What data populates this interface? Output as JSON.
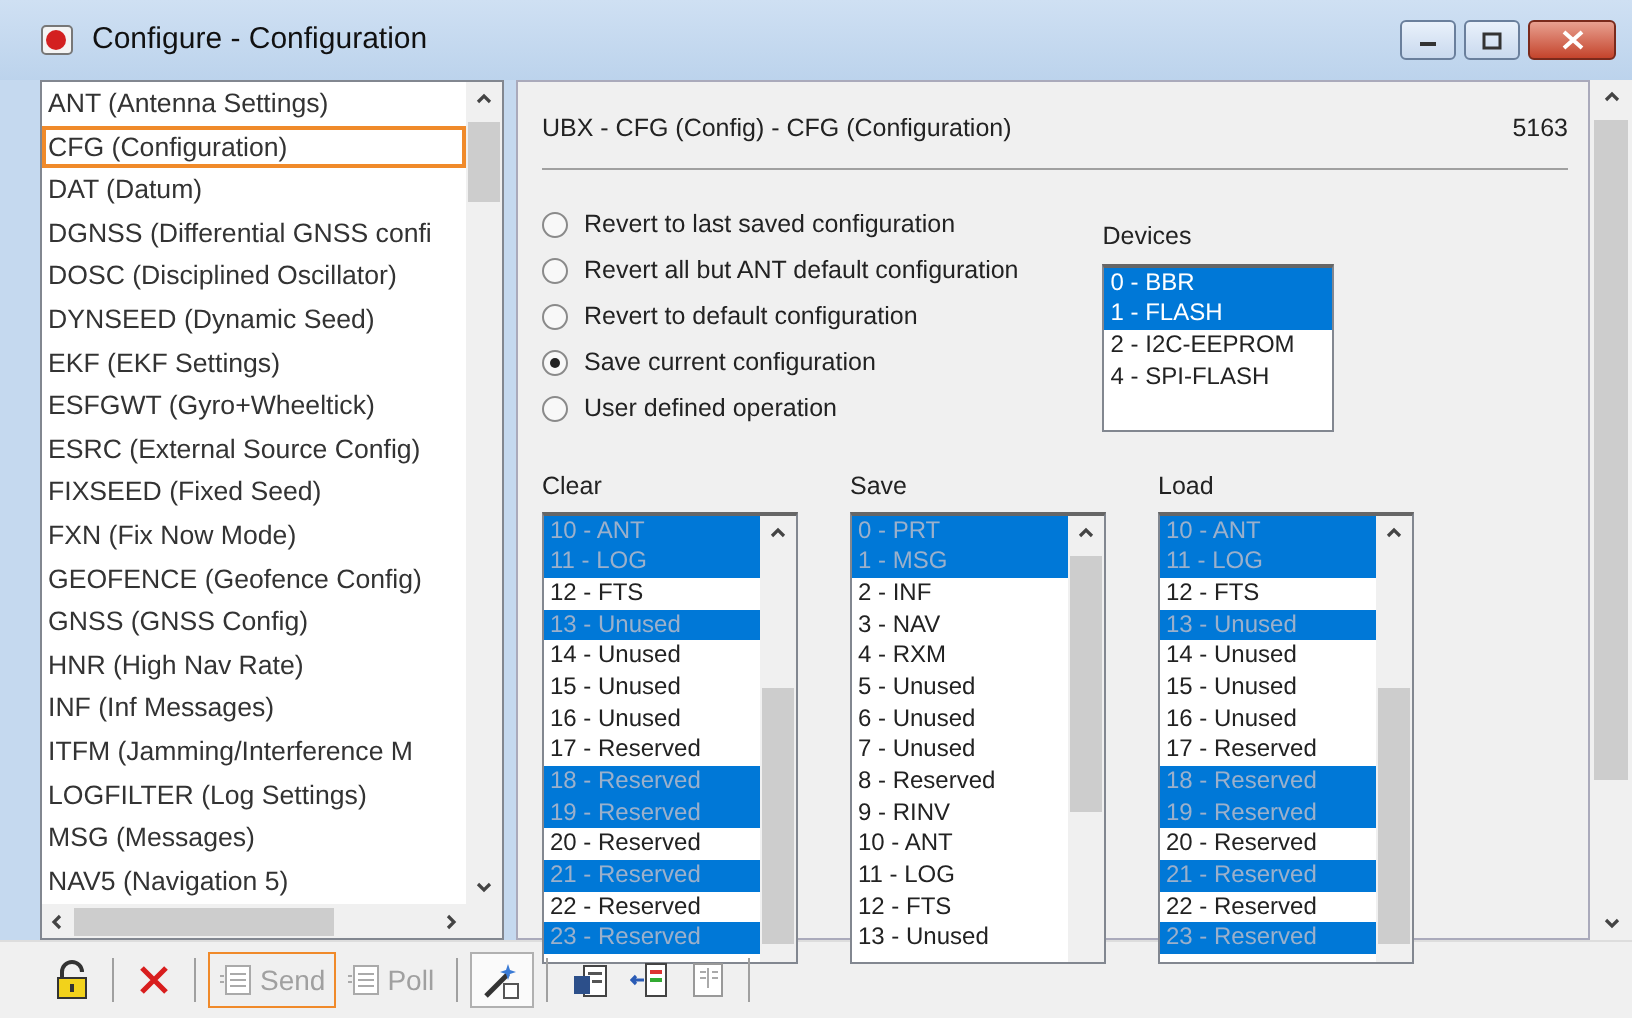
{
  "window": {
    "title": "Configure - Configuration"
  },
  "messages": [
    {
      "label": "ANT (Antenna Settings)",
      "selected": false
    },
    {
      "label": "CFG (Configuration)",
      "selected": true
    },
    {
      "label": "DAT (Datum)",
      "selected": false
    },
    {
      "label": "DGNSS (Differential GNSS confi",
      "selected": false
    },
    {
      "label": "DOSC (Disciplined Oscillator)",
      "selected": false
    },
    {
      "label": "DYNSEED (Dynamic Seed)",
      "selected": false
    },
    {
      "label": "EKF (EKF Settings)",
      "selected": false
    },
    {
      "label": "ESFGWT (Gyro+Wheeltick)",
      "selected": false
    },
    {
      "label": "ESRC (External Source Config)",
      "selected": false
    },
    {
      "label": "FIXSEED (Fixed Seed)",
      "selected": false
    },
    {
      "label": "FXN (Fix Now Mode)",
      "selected": false
    },
    {
      "label": "GEOFENCE (Geofence Config)",
      "selected": false
    },
    {
      "label": "GNSS (GNSS Config)",
      "selected": false
    },
    {
      "label": "HNR (High Nav Rate)",
      "selected": false
    },
    {
      "label": "INF (Inf Messages)",
      "selected": false
    },
    {
      "label": "ITFM (Jamming/Interference M",
      "selected": false
    },
    {
      "label": "LOGFILTER (Log Settings)",
      "selected": false
    },
    {
      "label": "MSG (Messages)",
      "selected": false
    },
    {
      "label": "NAV5 (Navigation 5)",
      "selected": false
    }
  ],
  "panel": {
    "header": "UBX - CFG (Config) - CFG (Configuration)",
    "number": "5163",
    "options": [
      {
        "label": "Revert to last saved configuration",
        "selected": false
      },
      {
        "label": "Revert all but ANT default configuration",
        "selected": false
      },
      {
        "label": "Revert to default configuration",
        "selected": false
      },
      {
        "label": "Save current configuration",
        "selected": true
      },
      {
        "label": "User defined operation",
        "selected": false
      }
    ],
    "devices": {
      "label": "Devices",
      "items": [
        {
          "label": "0 - BBR",
          "selected": true
        },
        {
          "label": "1 - FLASH",
          "selected": true
        },
        {
          "label": "2 - I2C-EEPROM",
          "selected": false
        },
        {
          "label": "4 - SPI-FLASH",
          "selected": false
        }
      ]
    },
    "masks": [
      {
        "label": "Clear",
        "items": [
          {
            "label": "10 - ANT",
            "selected": true
          },
          {
            "label": "11 - LOG",
            "selected": true
          },
          {
            "label": "12 - FTS",
            "selected": false
          },
          {
            "label": "13 - Unused",
            "selected": true
          },
          {
            "label": "14 - Unused",
            "selected": false
          },
          {
            "label": "15 - Unused",
            "selected": false
          },
          {
            "label": "16 - Unused",
            "selected": false
          },
          {
            "label": "17 - Reserved",
            "selected": false
          },
          {
            "label": "18 - Reserved",
            "selected": true
          },
          {
            "label": "19 - Reserved",
            "selected": true
          },
          {
            "label": "20 - Reserved",
            "selected": false
          },
          {
            "label": "21 - Reserved",
            "selected": true
          },
          {
            "label": "22 - Reserved",
            "selected": false
          },
          {
            "label": "23 - Reserved",
            "selected": true
          }
        ]
      },
      {
        "label": "Save",
        "items": [
          {
            "label": "0 - PRT",
            "selected": true
          },
          {
            "label": "1 - MSG",
            "selected": true
          },
          {
            "label": "2 - INF",
            "selected": false
          },
          {
            "label": "3 - NAV",
            "selected": false
          },
          {
            "label": "4 - RXM",
            "selected": false
          },
          {
            "label": "5 - Unused",
            "selected": false
          },
          {
            "label": "6 - Unused",
            "selected": false
          },
          {
            "label": "7 - Unused",
            "selected": false
          },
          {
            "label": "8 - Reserved",
            "selected": false
          },
          {
            "label": "9 - RINV",
            "selected": false
          },
          {
            "label": "10 - ANT",
            "selected": false
          },
          {
            "label": "11 - LOG",
            "selected": false
          },
          {
            "label": "12 - FTS",
            "selected": false
          },
          {
            "label": "13 - Unused",
            "selected": false
          }
        ]
      },
      {
        "label": "Load",
        "items": [
          {
            "label": "10 - ANT",
            "selected": true
          },
          {
            "label": "11 - LOG",
            "selected": true
          },
          {
            "label": "12 - FTS",
            "selected": false
          },
          {
            "label": "13 - Unused",
            "selected": true
          },
          {
            "label": "14 - Unused",
            "selected": false
          },
          {
            "label": "15 - Unused",
            "selected": false
          },
          {
            "label": "16 - Unused",
            "selected": false
          },
          {
            "label": "17 - Reserved",
            "selected": false
          },
          {
            "label": "18 - Reserved",
            "selected": true
          },
          {
            "label": "19 - Reserved",
            "selected": true
          },
          {
            "label": "20 - Reserved",
            "selected": false
          },
          {
            "label": "21 - Reserved",
            "selected": true
          },
          {
            "label": "22 - Reserved",
            "selected": false
          },
          {
            "label": "23 - Reserved",
            "selected": true
          }
        ]
      }
    ]
  },
  "toolbar": [
    {
      "kind": "lock"
    },
    {
      "kind": "separator"
    },
    {
      "kind": "delete"
    },
    {
      "kind": "separator"
    },
    {
      "kind": "send",
      "label": "Send",
      "disabled": true,
      "focused": true
    },
    {
      "kind": "poll",
      "label": "Poll",
      "disabled": true,
      "focused": false
    },
    {
      "kind": "separator"
    },
    {
      "kind": "wizard"
    },
    {
      "kind": "separator"
    },
    {
      "kind": "export"
    },
    {
      "kind": "import"
    },
    {
      "kind": "page"
    },
    {
      "kind": "separator"
    }
  ]
}
